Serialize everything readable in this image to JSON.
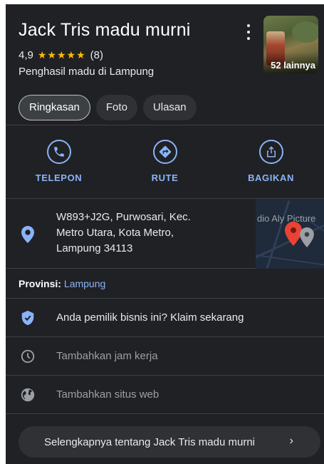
{
  "place": {
    "title": "Jack Tris madu murni",
    "rating": "4,9",
    "stars": "★★★★★",
    "review_count": "(8)",
    "category": "Penghasil madu di Lampung",
    "photos_more": "52 lainnya"
  },
  "tabs": [
    {
      "label": "Ringkasan",
      "active": true
    },
    {
      "label": "Foto",
      "active": false
    },
    {
      "label": "Ulasan",
      "active": false
    }
  ],
  "actions": [
    {
      "label": "TELEPON",
      "icon": "phone-icon"
    },
    {
      "label": "RUTE",
      "icon": "directions-icon"
    },
    {
      "label": "BAGIKAN",
      "icon": "share-icon"
    }
  ],
  "address": {
    "lines": [
      "W893+J2G, Purwosari, Kec.",
      "Metro Utara, Kota Metro,",
      "Lampung 34113"
    ],
    "map_label": "dio Aly Picture"
  },
  "province": {
    "key": "Provinsi:",
    "value": "Lampung"
  },
  "rows": [
    {
      "text": "Anda pemilik bisnis ini? Klaim sekarang",
      "icon": "verified-shield-icon"
    },
    {
      "text": "Tambahkan jam kerja",
      "icon": "clock-icon"
    },
    {
      "text": "Tambahkan situs web",
      "icon": "globe-icon"
    }
  ],
  "more_button": {
    "label": "Selengkapnya tentang Jack Tris madu murni",
    "chevron": "›"
  },
  "colors": {
    "background": "#202124",
    "accent_blue": "#8ab4f8",
    "star_yellow": "#fbbc04",
    "pin_red": "#ea4335",
    "divider": "#3c4043"
  }
}
